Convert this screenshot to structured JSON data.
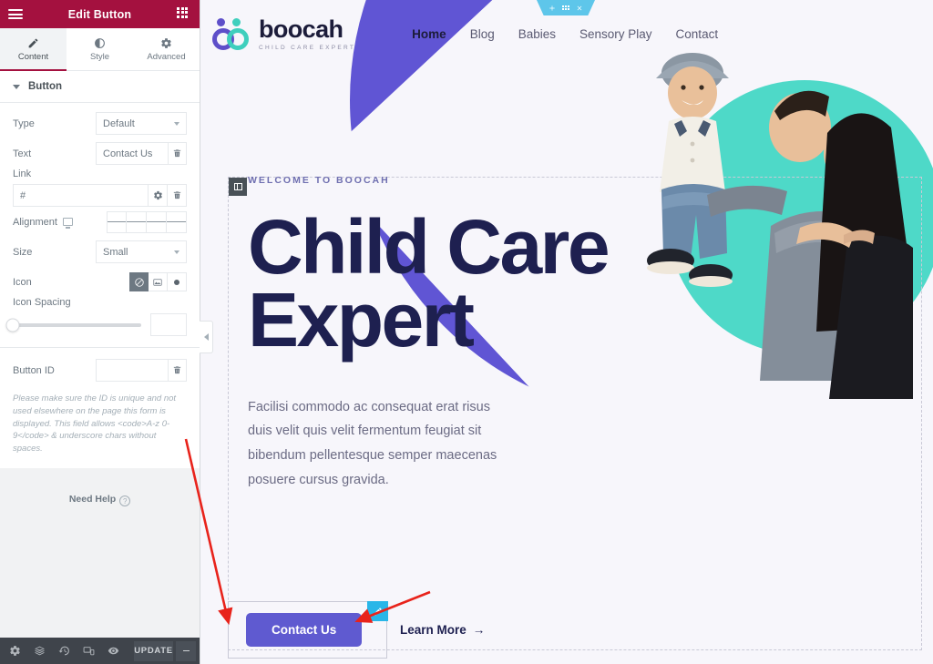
{
  "panel": {
    "header": {
      "title": "Edit Button",
      "menu_icon": "hamburger-icon",
      "apps_icon": "grid-icon"
    },
    "tabs": [
      {
        "label": "Content",
        "icon": "pencil-icon",
        "active": true
      },
      {
        "label": "Style",
        "icon": "contrast-icon",
        "active": false
      },
      {
        "label": "Advanced",
        "icon": "gear-icon",
        "active": false
      }
    ],
    "section": {
      "label": "Button"
    },
    "fields": {
      "type": {
        "label": "Type",
        "value": "Default"
      },
      "text": {
        "label": "Text",
        "value": "Contact Us"
      },
      "link": {
        "label": "Link",
        "value": "#",
        "placeholder": "#"
      },
      "alignment": {
        "label": "Alignment",
        "options": [
          "left",
          "center",
          "right",
          "justify"
        ]
      },
      "size": {
        "label": "Size",
        "value": "Small"
      },
      "icon": {
        "label": "Icon",
        "options": [
          "none",
          "media",
          "solid"
        ],
        "selected": 0
      },
      "icon_spacing": {
        "label": "Icon Spacing",
        "value": ""
      },
      "button_id": {
        "label": "Button ID",
        "value": "",
        "hint": "Please make sure the ID is unique and not used elsewhere on the page this form is displayed. This field allows <code>A-z 0-9</code> & underscore chars without spaces."
      }
    },
    "need_help": "Need Help",
    "footer": {
      "icons": [
        "gear-icon",
        "layers-icon",
        "history-icon",
        "responsive-icon",
        "preview-eye-icon"
      ],
      "update_label": "UPDATE"
    },
    "collapse_icon": "chevron-left-icon"
  },
  "site": {
    "logo": {
      "name": "boocah",
      "tagline": "CHILD CARE EXPERT"
    },
    "nav": [
      {
        "label": "Home",
        "active": true
      },
      {
        "label": "Blog",
        "active": false
      },
      {
        "label": "Babies",
        "active": false
      },
      {
        "label": "Sensory Play",
        "active": false
      },
      {
        "label": "Contact",
        "active": false
      }
    ],
    "hero": {
      "eyebrow": "WELCOME TO BOOCAH",
      "headline": "Child Care Expert",
      "description": "Facilisi commodo ac consequat erat risus duis velit quis velit fermentum feugiat sit bibendum pellentesque semper maecenas posuere cursus gravida.",
      "primary_button": "Contact Us",
      "secondary_link": "Learn More",
      "secondary_arrow": "→"
    },
    "section_toolbar": {
      "add_icon": "plus-icon",
      "drag_icon": "dots-grid-icon",
      "close_icon": "close-icon"
    },
    "edit_handle_icon": "pencil-icon",
    "widget_handle_icon": "column-icon"
  },
  "colors": {
    "panel_header": "#a4113f",
    "accent_purple": "#5f5ad0",
    "hero_blob": "#6055d4",
    "teal_circle": "#4ed9c8",
    "edit_handle": "#29b6e8",
    "section_tab": "#5ec6ea",
    "headline": "#1e2050",
    "annotation_arrow": "#e8231b"
  }
}
